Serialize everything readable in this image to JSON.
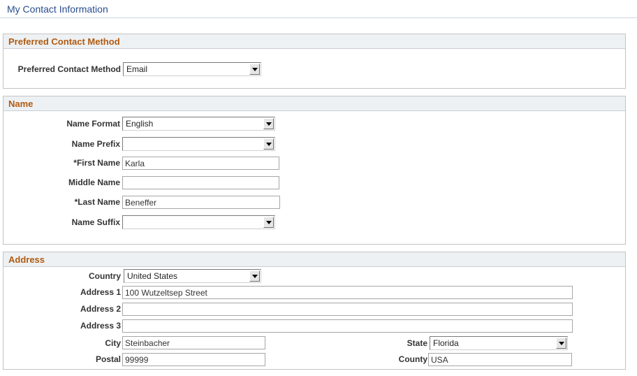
{
  "page": {
    "title": "My Contact Information"
  },
  "preferred": {
    "header": "Preferred Contact Method",
    "method_label": "Preferred Contact Method",
    "method_value": "Email"
  },
  "name": {
    "header": "Name",
    "format_label": "Name Format",
    "format_value": "English",
    "prefix_label": "Name Prefix",
    "prefix_value": "",
    "first_label": "*First Name",
    "first_value": "Karla",
    "middle_label": "Middle Name",
    "middle_value": "",
    "last_label": "*Last Name",
    "last_value": "Beneffer",
    "suffix_label": "Name Suffix",
    "suffix_value": ""
  },
  "address": {
    "header": "Address",
    "country_label": "Country",
    "country_value": "United States",
    "address1_label": "Address 1",
    "address1_value": "100 Wutzeltsep Street",
    "address2_label": "Address 2",
    "address2_value": "",
    "address3_label": "Address 3",
    "address3_value": "",
    "city_label": "City",
    "city_value": "Steinbacher",
    "state_label": "State",
    "state_value": "Florida",
    "postal_label": "Postal",
    "postal_value": "99999",
    "county_label": "County",
    "county_value": "USA"
  },
  "colors": {
    "title": "#2a4d8f",
    "section_header_text": "#b05a12",
    "section_header_bg": "#eef1f3"
  },
  "icons": {
    "dropdown": "chevron-down-icon"
  }
}
